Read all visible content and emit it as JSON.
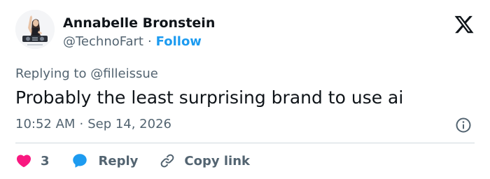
{
  "author": {
    "name": "Annabelle Bronstein",
    "handle": "@TechnoFart",
    "separator": "·",
    "follow_label": "Follow",
    "avatar_icon": "dj-avatar"
  },
  "brand_icon": "x-logo-icon",
  "reply_context": {
    "prefix": "Replying to",
    "mention": "@filleissue"
  },
  "tweet": {
    "text": "Probably the least surprising brand to use ai",
    "time": "10:52 AM",
    "separator": "·",
    "date": "Sep 14, 2026"
  },
  "actions": {
    "like_count": "3",
    "reply_label": "Reply",
    "copy_label": "Copy link"
  },
  "colors": {
    "text": "#0f1419",
    "secondary": "#536471",
    "link": "#1d9bf0",
    "like": "#f91880",
    "reply": "#1d9bf0",
    "divider": "#cfd9de"
  }
}
